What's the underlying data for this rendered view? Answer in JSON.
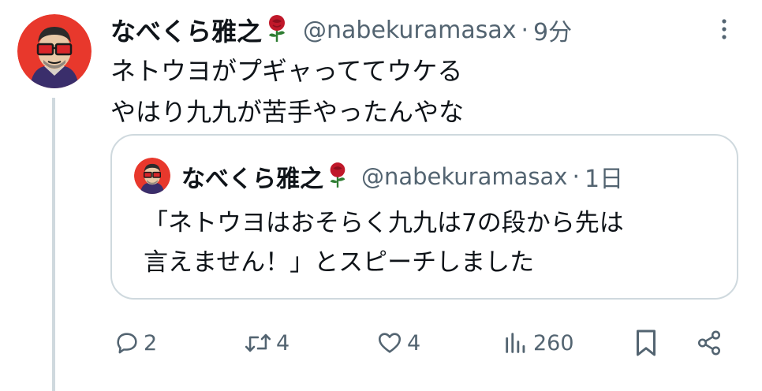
{
  "post": {
    "author_name": "なべくら雅之",
    "author_handle": "@nabekuramasax",
    "separator": "·",
    "time": "9分",
    "lines": [
      "ネトウヨがプギャっててウケる",
      "やはり九九が苦手やったんやな"
    ],
    "avatar_icon": "avatar-glasses-man",
    "name_badge_icon": "rose-icon",
    "more_icon": "more-vertical-icon"
  },
  "quote": {
    "author_name": "なべくら雅之",
    "author_handle": "@nabekuramasax",
    "separator": "·",
    "time": "1日",
    "lines": [
      "「ネトウヨはおそらく九九は7の段から先は",
      "言えません！」とスピーチしました"
    ]
  },
  "actions": {
    "reply_count": "2",
    "repost_count": "4",
    "like_count": "4",
    "views_count": "260",
    "icons": [
      "reply-icon",
      "repost-icon",
      "like-icon",
      "views-icon",
      "bookmark-icon",
      "share-icon"
    ]
  },
  "colors": {
    "text_primary": "#0f1419",
    "text_secondary": "#536471",
    "border": "#cfd9de",
    "avatar_bg": "#e8382c",
    "rose": "#c0182a"
  }
}
